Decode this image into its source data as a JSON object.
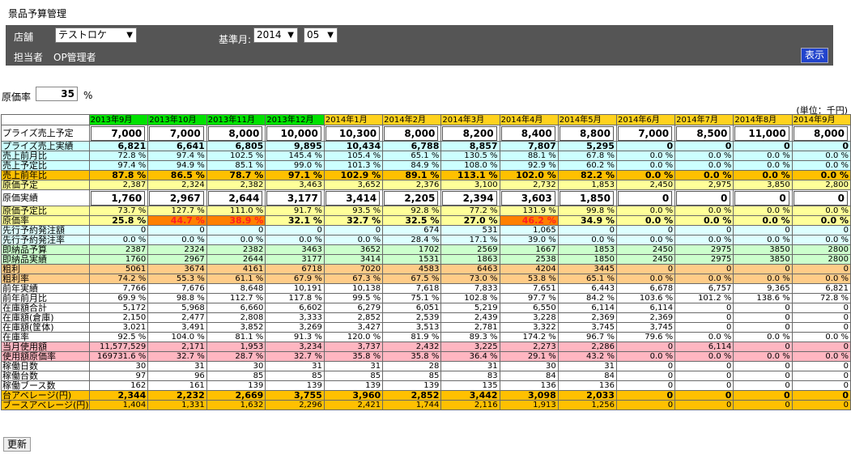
{
  "page_title": "景品予算管理",
  "filters": {
    "store_label": "店舗",
    "store_value": "テストロケ",
    "base_month_label": "基準月:",
    "year_value": "2014",
    "month_value": "05",
    "person_label": "担当者",
    "person_value": "OP管理者",
    "show_button": "表示"
  },
  "cost_rate": {
    "label": "原価率",
    "value": "35",
    "unit": "%"
  },
  "unit_note": "(単位：千円)",
  "update_button": "更新",
  "colors": {
    "header_green": "#00e200",
    "header_yellow": "#ffd21e",
    "cyan": "#ccffff",
    "light_cyan": "#ddffff",
    "light_green": "#ccffcc",
    "orange": "#ffcc88",
    "pink": "#ffb6c1",
    "gold": "#ffc000",
    "alert_orange": "#ff7f00"
  },
  "months": [
    "2013年9月",
    "2013年10月",
    "2013年11月",
    "2013年12月",
    "2014年1月",
    "2014年2月",
    "2014年3月",
    "2014年4月",
    "2014年5月",
    "2014年6月",
    "2014年7月",
    "2014年8月",
    "2014年9月"
  ],
  "rows": [
    {
      "label": "プライズ売上予定",
      "style": "input",
      "values": [
        "7,000",
        "7,000",
        "8,000",
        "10,000",
        "10,300",
        "8,000",
        "8,200",
        "8,400",
        "8,800",
        "7,000",
        "8,500",
        "11,000",
        "8,000"
      ]
    },
    {
      "label": "プライズ売上実績",
      "style": "cyan-bold",
      "values": [
        "6,821",
        "6,641",
        "6,805",
        "9,895",
        "10,434",
        "6,788",
        "8,857",
        "7,807",
        "5,295",
        "0",
        "0",
        "0",
        "0"
      ]
    },
    {
      "label": "売上前月比",
      "style": "cyan",
      "values": [
        "72.8 %",
        "97.4 %",
        "102.5 %",
        "145.4 %",
        "105.4 %",
        "65.1 %",
        "130.5 %",
        "88.1 %",
        "67.8 %",
        "0.0 %",
        "0.0 %",
        "0.0 %",
        "0.0 %"
      ]
    },
    {
      "label": "売上予定比",
      "style": "cyan",
      "values": [
        "97.4 %",
        "94.9 %",
        "85.1 %",
        "99.0 %",
        "101.3 %",
        "84.9 %",
        "108.0 %",
        "92.9 %",
        "60.2 %",
        "0.0 %",
        "0.0 %",
        "0.0 %",
        "0.0 %"
      ]
    },
    {
      "label": "売上前年比",
      "style": "gold-bold",
      "values": [
        "87.8 %",
        "86.5 %",
        "78.7 %",
        "97.1 %",
        "102.9 %",
        "89.1 %",
        "113.1 %",
        "102.0 %",
        "82.2 %",
        "0.0 %",
        "0.0 %",
        "0.0 %",
        "0.0 %"
      ]
    },
    {
      "label": "原価予定",
      "style": "yellow",
      "values": [
        "2,387",
        "2,324",
        "2,382",
        "3,463",
        "3,652",
        "2,376",
        "3,100",
        "2,732",
        "1,853",
        "2,450",
        "2,975",
        "3,850",
        "2,800"
      ]
    },
    {
      "label": "原価実績",
      "style": "input",
      "values": [
        "1,760",
        "2,967",
        "2,644",
        "3,177",
        "3,414",
        "2,205",
        "2,394",
        "3,603",
        "1,850",
        "0",
        "0",
        "0",
        "0"
      ]
    },
    {
      "label": "原価予定比",
      "style": "yellow",
      "values": [
        "73.7 %",
        "127.7 %",
        "111.0 %",
        "91.7 %",
        "93.5 %",
        "92.8 %",
        "77.2 %",
        "131.9 %",
        "99.8 %",
        "0.0 %",
        "0.0 %",
        "0.0 %",
        "0.0 %"
      ]
    },
    {
      "label": "原価率",
      "style": "yellow-bold",
      "values": [
        "25.8 %",
        "44.7 %",
        "38.9 %",
        "32.1 %",
        "32.7 %",
        "32.5 %",
        "27.0 %",
        "46.2 %",
        "34.9 %",
        "0.0 %",
        "0.0 %",
        "0.0 %",
        "0.0 %"
      ],
      "alerts": [
        1,
        2,
        7
      ]
    },
    {
      "label": "先行予約発注額",
      "style": "lcyan",
      "values": [
        "0",
        "0",
        "0",
        "0",
        "0",
        "674",
        "531",
        "1,065",
        "0",
        "0",
        "0",
        "0",
        "0"
      ]
    },
    {
      "label": "先行予約発注率",
      "style": "lcyan",
      "values": [
        "0.0 %",
        "0.0 %",
        "0.0 %",
        "0.0 %",
        "0.0 %",
        "28.4 %",
        "17.1 %",
        "39.0 %",
        "0.0 %",
        "0.0 %",
        "0.0 %",
        "0.0 %",
        "0.0 %"
      ]
    },
    {
      "label": "即納品予算",
      "style": "green",
      "values": [
        "2387",
        "2324",
        "2382",
        "3463",
        "3652",
        "1702",
        "2569",
        "1667",
        "1853",
        "2450",
        "2975",
        "3850",
        "2800"
      ]
    },
    {
      "label": "即納品実績",
      "style": "green",
      "values": [
        "1760",
        "2967",
        "2644",
        "3177",
        "3414",
        "1531",
        "1863",
        "2538",
        "1850",
        "2450",
        "2975",
        "3850",
        "2800"
      ]
    },
    {
      "label": "粗利",
      "style": "orange",
      "values": [
        "5061",
        "3674",
        "4161",
        "6718",
        "7020",
        "4583",
        "6463",
        "4204",
        "3445",
        "0",
        "0",
        "0",
        "0"
      ]
    },
    {
      "label": "粗利率",
      "style": "orange",
      "values": [
        "74.2 %",
        "55.3 %",
        "61.1 %",
        "67.9 %",
        "67.3 %",
        "67.5 %",
        "73.0 %",
        "53.8 %",
        "65.1 %",
        "0.0 %",
        "0.0 %",
        "0.0 %",
        "0.0 %"
      ]
    },
    {
      "label": "前年実績",
      "style": "white",
      "values": [
        "7,766",
        "7,676",
        "8,648",
        "10,191",
        "10,138",
        "7,618",
        "7,833",
        "7,651",
        "6,443",
        "6,678",
        "6,757",
        "9,365",
        "6,821"
      ]
    },
    {
      "label": "前年前月比",
      "style": "white",
      "values": [
        "69.9 %",
        "98.8 %",
        "112.7 %",
        "117.8 %",
        "99.5 %",
        "75.1 %",
        "102.8 %",
        "97.7 %",
        "84.2 %",
        "103.6 %",
        "101.2 %",
        "138.6 %",
        "72.8 %"
      ]
    },
    {
      "label": "在庫額合計",
      "style": "white",
      "values": [
        "5,172",
        "5,968",
        "6,660",
        "6,602",
        "6,279",
        "6,051",
        "5,219",
        "6,550",
        "6,114",
        "6,114",
        "0",
        "0",
        "0"
      ]
    },
    {
      "label": "在庫額(倉庫)",
      "style": "white",
      "values": [
        "2,150",
        "2,477",
        "2,808",
        "3,333",
        "2,852",
        "2,539",
        "2,439",
        "3,228",
        "2,369",
        "2,369",
        "0",
        "0",
        "0"
      ]
    },
    {
      "label": "在庫額(筐体)",
      "style": "white",
      "values": [
        "3,021",
        "3,491",
        "3,852",
        "3,269",
        "3,427",
        "3,513",
        "2,781",
        "3,322",
        "3,745",
        "3,745",
        "0",
        "0",
        "0"
      ]
    },
    {
      "label": "在庫率",
      "style": "white",
      "values": [
        "92.5 %",
        "104.0 %",
        "81.1 %",
        "91.3 %",
        "120.0 %",
        "81.9 %",
        "89.3 %",
        "174.2 %",
        "96.7 %",
        "79.6 %",
        "0.0 %",
        "0.0 %",
        "0.0 %"
      ]
    },
    {
      "label": "当月使用額",
      "style": "pink",
      "values": [
        "11,577,529",
        "2,171",
        "1,953",
        "3,234",
        "3,737",
        "2,432",
        "3,225",
        "2,273",
        "2,286",
        "0",
        "6,114",
        "0",
        "0"
      ]
    },
    {
      "label": "使用額原価率",
      "style": "pink",
      "values": [
        "169731.6 %",
        "32.7 %",
        "28.7 %",
        "32.7 %",
        "35.8 %",
        "35.8 %",
        "36.4 %",
        "29.1 %",
        "43.2 %",
        "0.0 %",
        "0.0 %",
        "0.0 %",
        "0.0 %"
      ]
    },
    {
      "label": "稼働日数",
      "style": "white",
      "values": [
        "30",
        "31",
        "30",
        "31",
        "31",
        "28",
        "31",
        "30",
        "31",
        "0",
        "0",
        "0",
        "0"
      ]
    },
    {
      "label": "稼働台数",
      "style": "white",
      "values": [
        "97",
        "96",
        "85",
        "85",
        "85",
        "85",
        "83",
        "84",
        "84",
        "0",
        "0",
        "0",
        "0"
      ]
    },
    {
      "label": "稼働ブース数",
      "style": "white",
      "values": [
        "162",
        "161",
        "139",
        "139",
        "139",
        "139",
        "135",
        "136",
        "136",
        "0",
        "0",
        "0",
        "0"
      ]
    },
    {
      "label": "台アベレージ(円)",
      "style": "gold-bold",
      "values": [
        "2,344",
        "2,232",
        "2,669",
        "3,755",
        "3,960",
        "2,852",
        "3,442",
        "3,098",
        "2,033",
        "0",
        "0",
        "0",
        "0"
      ]
    },
    {
      "label": "ブースアベレージ(円)",
      "style": "gold",
      "values": [
        "1,404",
        "1,331",
        "1,632",
        "2,296",
        "2,421",
        "1,744",
        "2,116",
        "1,913",
        "1,256",
        "0",
        "0",
        "0",
        "0"
      ]
    }
  ]
}
